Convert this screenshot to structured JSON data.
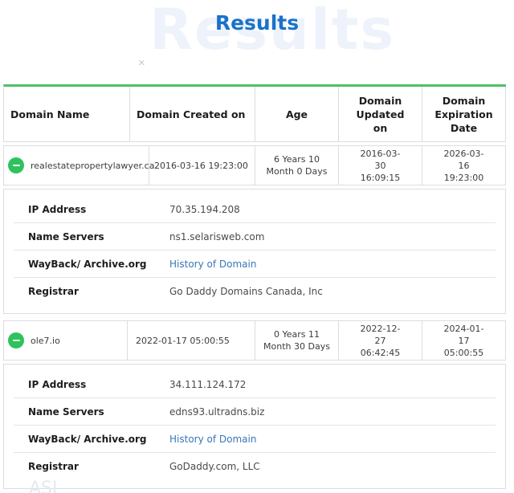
{
  "page": {
    "title": "Results",
    "watermark": "Results",
    "close_glyph": "×",
    "footer_watermark": "ASI"
  },
  "table": {
    "headers": {
      "domain_name": "Domain Name",
      "created_on": "Domain Created on",
      "age": "Age",
      "updated_on": "Domain Updated on",
      "expiration": "Domain Expiration Date"
    },
    "labels": {
      "ip": "IP Address",
      "ns": "Name Servers",
      "wayback": "WayBack/ Archive.org",
      "registrar": "Registrar"
    },
    "rows": [
      {
        "domain": "realestatepropertylawyer.ca",
        "created": "2016-03-16 19:23:00",
        "age": "6 Years 10 Month 0 Days",
        "updated": "2016-03-30 16:09:15",
        "expiration": "2026-03-16 19:23:00",
        "ip": "70.35.194.208",
        "name_servers": "ns1.selarisweb.com",
        "wayback": "History of Domain",
        "registrar": "Go Daddy Domains Canada, Inc"
      },
      {
        "domain": "ole7.io",
        "created": "2022-01-17 05:00:55",
        "age": "0 Years 11 Month 30 Days",
        "updated": "2022-12-27 06:42:45",
        "expiration": "2024-01-17 05:00:55",
        "ip": "34.111.124.172",
        "name_servers": "edns93.ultradns.biz",
        "wayback": "History of Domain",
        "registrar": "GoDaddy.com, LLC"
      }
    ]
  },
  "colors": {
    "title": "#1a72c9",
    "accent_green": "#2ec25d",
    "link": "#3a76b8"
  },
  "icons": {
    "collapse": "minus-circle-icon",
    "close": "close-icon"
  }
}
